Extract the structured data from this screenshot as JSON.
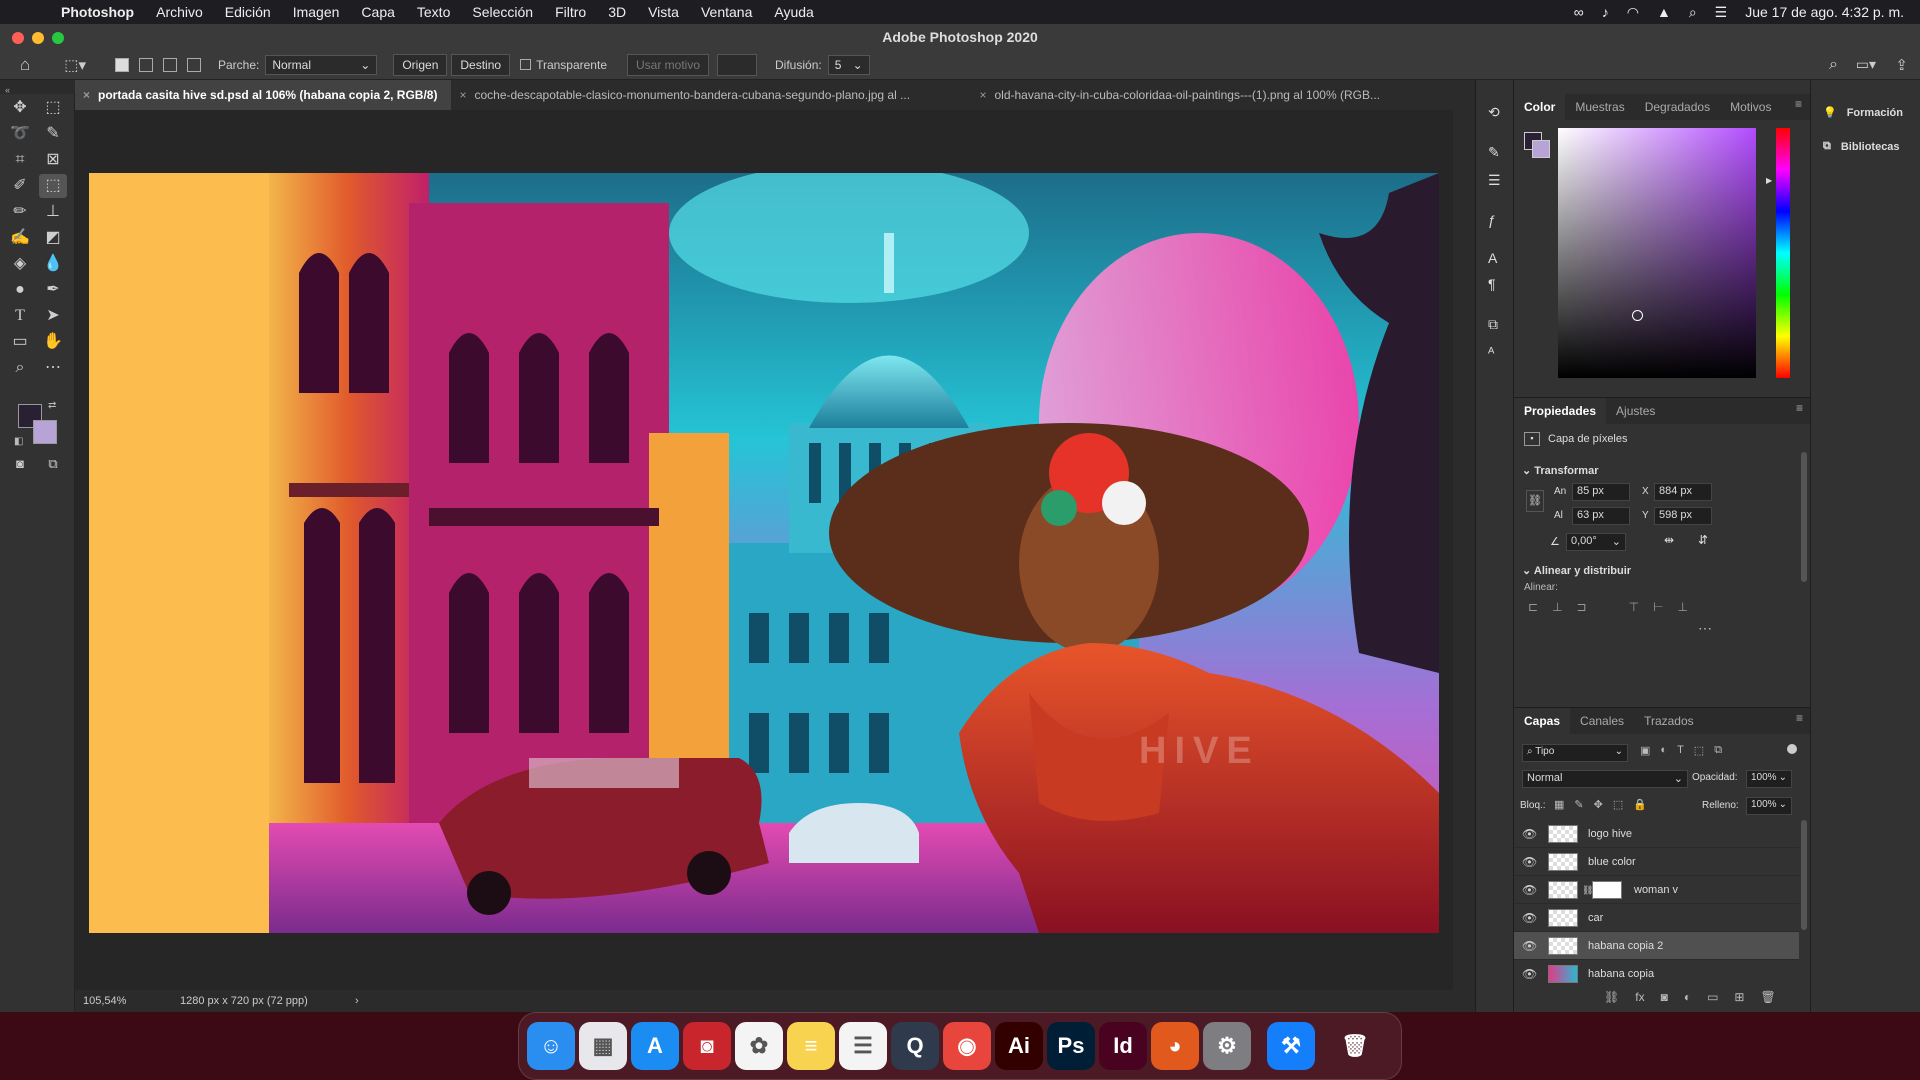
{
  "menubar": {
    "app_name": "Photoshop",
    "menus": [
      "Archivo",
      "Edición",
      "Imagen",
      "Capa",
      "Texto",
      "Selección",
      "Filtro",
      "3D",
      "Vista",
      "Ventana",
      "Ayuda"
    ],
    "clock": "Jue 17 de ago.  4:32 p. m."
  },
  "window": {
    "title": "Adobe Photoshop 2020"
  },
  "options_bar": {
    "patch_label": "Parche:",
    "patch_mode": "Normal",
    "source_label": "Origen",
    "dest_label": "Destino",
    "transparent_label": "Transparente",
    "use_pattern_label": "Usar motivo",
    "diffusion_label": "Difusión:",
    "diffusion_value": "5"
  },
  "tabs": [
    {
      "label": "portada  casita hive sd.psd al 106% (habana copia 2, RGB/8)",
      "active": true
    },
    {
      "label": "coche-descapotable-clasico-monumento-bandera-cubana-segundo-plano.jpg al ...",
      "active": false
    },
    {
      "label": "old-havana-city-in-cuba-coloridaa-oil-paintings---(1).png al 100% (RGB...",
      "active": false
    }
  ],
  "status": {
    "zoom": "105,54%",
    "doc_size": "1280 px x 720 px (72 ppp)"
  },
  "color_panel": {
    "tabs": [
      "Color",
      "Muestras",
      "Degradados",
      "Motivos"
    ],
    "foreground": "#2a2033",
    "background": "#b7a3d6"
  },
  "properties_panel": {
    "tabs": [
      "Propiedades",
      "Ajustes"
    ],
    "layer_type": "Capa de píxeles",
    "transform_title": "Transformar",
    "w_label": "An",
    "w_value": "85 px",
    "h_label": "Al",
    "h_value": "63 px",
    "x_label": "X",
    "x_value": "884 px",
    "y_label": "Y",
    "y_value": "598 px",
    "angle_value": "0,00°",
    "align_title": "Alinear y distribuir",
    "align_label": "Alinear:"
  },
  "layers_panel": {
    "tabs": [
      "Capas",
      "Canales",
      "Trazados"
    ],
    "filter_label": "Tipo",
    "blend_mode": "Normal",
    "opacity_label": "Opacidad:",
    "opacity_value": "100%",
    "lock_label": "Bloq.:",
    "fill_label": "Relleno:",
    "fill_value": "100%",
    "layers": [
      {
        "name": "logo hive"
      },
      {
        "name": "blue color"
      },
      {
        "name": "woman v"
      },
      {
        "name": "car"
      },
      {
        "name": "habana copia 2"
      },
      {
        "name": "habana copia"
      }
    ]
  },
  "right_panel": {
    "items": [
      "Formación",
      "Bibliotecas"
    ]
  },
  "canvas": {
    "watermark": "HIVE"
  },
  "dock": {
    "apps": [
      {
        "name": "Finder",
        "glyph": "☺",
        "color": "#2a8df0"
      },
      {
        "name": "Launchpad",
        "glyph": "▦",
        "color": "#e8e8ec"
      },
      {
        "name": "App Store",
        "glyph": "A",
        "color": "#1b8cf2"
      },
      {
        "name": "Photo Booth",
        "glyph": "◙",
        "color": "#c8262c"
      },
      {
        "name": "Photos",
        "glyph": "✿",
        "color": "#f4f4f4"
      },
      {
        "name": "Notes",
        "glyph": "≡",
        "color": "#f7d350"
      },
      {
        "name": "Reminders",
        "glyph": "☰",
        "color": "#f4f4f4"
      },
      {
        "name": "QuickTime",
        "glyph": "Q",
        "color": "#2f3a4c"
      },
      {
        "name": "Chrome",
        "glyph": "◉",
        "color": "#e8453c"
      },
      {
        "name": "Illustrator",
        "glyph": "Ai",
        "color": "#330000"
      },
      {
        "name": "Photoshop",
        "glyph": "Ps",
        "color": "#001e36"
      },
      {
        "name": "InDesign",
        "glyph": "Id",
        "color": "#49021f"
      },
      {
        "name": "Firefox",
        "glyph": "◕",
        "color": "#e2591e"
      },
      {
        "name": "System Preferences",
        "glyph": "⚙",
        "color": "#7d7d82"
      },
      {
        "name": "Xcode",
        "glyph": "⚒",
        "color": "#147efb"
      },
      {
        "name": "Trash",
        "glyph": "🗑",
        "color": "#9aa0a6"
      }
    ]
  }
}
